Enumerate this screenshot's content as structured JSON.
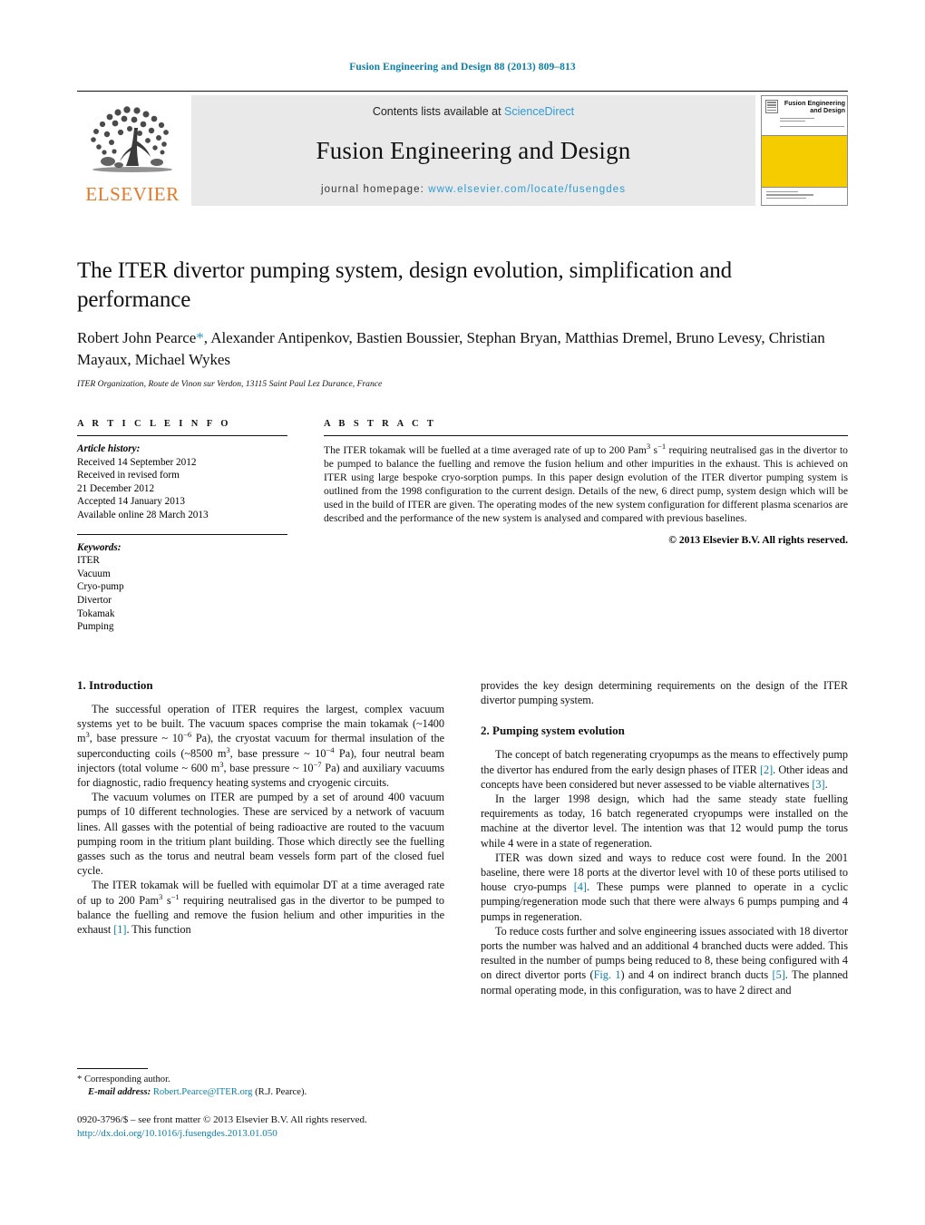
{
  "running_head": "Fusion Engineering and Design 88 (2013) 809–813",
  "masthead": {
    "publisher_name": "ELSEVIER",
    "contents_prefix": "Contents lists available at",
    "contents_link": "ScienceDirect",
    "journal_title": "Fusion Engineering and Design",
    "homepage_prefix": "journal homepage:",
    "homepage_url": "www.elsevier.com/locate/fusengdes",
    "cover": {
      "title_line1": "Fusion Engineering",
      "title_line2": "and Design",
      "accent_color": "#F5CC00"
    }
  },
  "article": {
    "title": "The ITER divertor pumping system, design evolution, simplification and performance",
    "authors": "Robert John Pearce*, Alexander Antipenkov, Bastien Boussier, Stephan Bryan, Matthias Dremel, Bruno Levesy, Christian Mayaux, Michael Wykes",
    "authors_before_star": "Robert John Pearce",
    "authors_after_star": ", Alexander Antipenkov, Bastien Boussier, Stephan Bryan, Matthias Dremel, Bruno Levesy, Christian Mayaux, Michael Wykes",
    "affiliation": "ITER Organization, Route de Vinon sur Verdon, 13115 Saint Paul Lez Durance, France"
  },
  "info": {
    "heading": "A R T I C L E   I N F O",
    "history_label": "Article history:",
    "history_lines": [
      "Received 14 September 2012",
      "Received in revised form",
      "21 December 2012",
      "Accepted 14 January 2013",
      "Available online 28 March 2013"
    ],
    "keywords_label": "Keywords:",
    "keywords": [
      "ITER",
      "Vacuum",
      "Cryo-pump",
      "Divertor",
      "Tokamak",
      "Pumping"
    ]
  },
  "abstract": {
    "heading": "A B S T R A C T",
    "text_part1": "The ITER tokamak will be fuelled at a time averaged rate of up to 200 Pam",
    "text_sup1": "3",
    "text_part2": " s",
    "text_sup2": "−1",
    "text_part3": " requiring neutralised gas in the divertor to be pumped to balance the fuelling and remove the fusion helium and other impurities in the exhaust. This is achieved on ITER using large bespoke cryo-sorption pumps. In this paper design evolution of the ITER divertor pumping system is outlined from the 1998 configuration to the current design. Details of the new, 6 direct pump, system design which will be used in the build of ITER are given. The operating modes of the new system configuration for different plasma scenarios are described and the performance of the new system is analysed and compared with previous baselines.",
    "copyright": "© 2013 Elsevier B.V. All rights reserved."
  },
  "sections": {
    "intro_heading": "1.  Introduction",
    "intro_p1_a": "The successful operation of ITER requires the largest, complex vacuum systems yet to be built. The vacuum spaces comprise the main tokamak (~1400 m",
    "intro_p1_b": ", base pressure ~ 10",
    "intro_p1_c": " Pa), the cryostat vacuum for thermal insulation of the superconducting coils (~8500 m",
    "intro_p1_d": ", base pressure ~ 10",
    "intro_p1_e": " Pa), four neutral beam injectors (total volume ~ 600 m",
    "intro_p1_f": ", base pressure ~ 10",
    "intro_p1_g": " Pa) and auxiliary vacuums for diagnostic, radio frequency heating systems and cryogenic circuits.",
    "sup_3": "3",
    "sup_m6": "−6",
    "sup_m4": "−4",
    "sup_m7": "−7",
    "sup_m1": "−1",
    "intro_p2": "The vacuum volumes on ITER are pumped by a set of around 400 vacuum pumps of 10 different technologies. These are serviced by a network of vacuum lines. All gasses with the potential of being radioactive are routed to the vacuum pumping room in the tritium plant building. Those which directly see the fuelling gasses such as the torus and neutral beam vessels form part of the closed fuel cycle.",
    "intro_p3_a": "The ITER tokamak will be fuelled with equimolar DT at a time averaged rate of up to 200 Pam",
    "intro_p3_b": " s",
    "intro_p3_c": " requiring neutralised gas in the divertor to be pumped to balance the fuelling and remove the fusion helium and other impurities in the exhaust ",
    "intro_p3_ref": "[1]",
    "intro_p3_d": ". This function",
    "right_p1": "provides the key design determining requirements on the design of the ITER divertor pumping system.",
    "evolution_heading": "2.  Pumping system evolution",
    "evo_p1_a": "The concept of batch regenerating cryopumps as the means to effectively pump the divertor has endured from the early design phases of ITER ",
    "evo_p1_ref1": "[2]",
    "evo_p1_b": ". Other ideas and concepts have been considered but never assessed to be viable alternatives ",
    "evo_p1_ref2": "[3]",
    "evo_p1_c": ".",
    "evo_p2": "In the larger 1998 design, which had the same steady state fuelling requirements as today, 16 batch regenerated cryopumps were installed on the machine at the divertor level. The intention was that 12 would pump the torus while 4 were in a state of regeneration.",
    "evo_p3_a": "ITER was down sized and ways to reduce cost were found. In the 2001 baseline, there were 18 ports at the divertor level with 10 of these ports utilised to house cryo-pumps ",
    "evo_p3_ref": "[4]",
    "evo_p3_b": ". These pumps were planned to operate in a cyclic pumping/regeneration mode such that there were always 6 pumps pumping and 4 pumps in regeneration.",
    "evo_p4_a": "To reduce costs further and solve engineering issues associated with 18 divertor ports the number was halved and an additional 4 branched ducts were added. This resulted in the number of pumps being reduced to 8, these being configured with 4 on direct divertor ports (",
    "evo_p4_fig": "Fig. 1",
    "evo_p4_b": ") and 4 on indirect branch ducts ",
    "evo_p4_ref": "[5]",
    "evo_p4_c": ". The planned normal operating mode, in this configuration, was to have 2 direct and"
  },
  "footnote": {
    "marker": "*",
    "corresponding": "Corresponding author.",
    "email_label": "E-mail address:",
    "email": "Robert.Pearce@ITER.org",
    "email_suffix": "(R.J. Pearce)."
  },
  "page_footer": {
    "issn_line": "0920-3796/$ – see front matter © 2013 Elsevier B.V. All rights reserved.",
    "doi": "http://dx.doi.org/10.1016/j.fusengdes.2013.01.050"
  },
  "colors": {
    "link": "#0b7fab",
    "link_light": "#2e9bd6",
    "elsevier_orange": "#E87722",
    "cover_yellow": "#F5CC00",
    "banner_gray": "#e9e9e9"
  }
}
